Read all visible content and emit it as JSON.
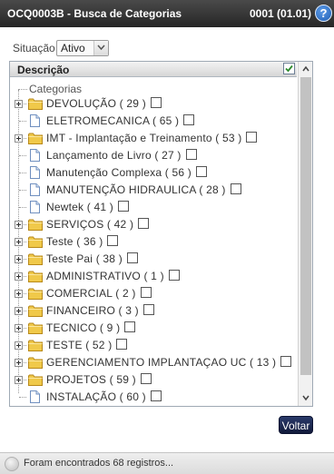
{
  "window": {
    "title": "OCQ0003B - Busca de Categorias",
    "code": "0001 (01.01)",
    "help_icon": "?"
  },
  "filter": {
    "label": "Situação",
    "selected": "Ativo"
  },
  "panel": {
    "column_header": "Descrição",
    "header_checked": true
  },
  "tree": {
    "root": "Categorias",
    "items": [
      {
        "label": "DEVOLUÇÃO ( 29 )",
        "type": "folder",
        "expandable": true
      },
      {
        "label": "ELETROMECANICA ( 65 )",
        "type": "document",
        "expandable": false
      },
      {
        "label": "IMT - Implantação e Treinamento ( 53 )",
        "type": "folder",
        "expandable": true
      },
      {
        "label": "Lançamento de Livro ( 27 )",
        "type": "document",
        "expandable": false
      },
      {
        "label": "Manutenção Complexa ( 56 )",
        "type": "document",
        "expandable": false
      },
      {
        "label": "MANUTENÇÃO HIDRAULICA ( 28 )",
        "type": "document",
        "expandable": false
      },
      {
        "label": "Newtek ( 41 )",
        "type": "document",
        "expandable": false
      },
      {
        "label": "SERVIÇOS ( 42 )",
        "type": "folder",
        "expandable": true
      },
      {
        "label": "Teste ( 36 )",
        "type": "folder",
        "expandable": true
      },
      {
        "label": "Teste Pai ( 38 )",
        "type": "folder",
        "expandable": true
      },
      {
        "label": "ADMINISTRATIVO ( 1 )",
        "type": "folder",
        "expandable": true
      },
      {
        "label": "COMERCIAL ( 2 )",
        "type": "folder",
        "expandable": true
      },
      {
        "label": "FINANCEIRO ( 3 )",
        "type": "folder",
        "expandable": true
      },
      {
        "label": "TECNICO ( 9 )",
        "type": "folder",
        "expandable": true
      },
      {
        "label": "TESTE ( 52 )",
        "type": "folder",
        "expandable": true
      },
      {
        "label": "GERENCIAMENTO IMPLANTAÇAO UC ( 13 )",
        "type": "folder",
        "expandable": true
      },
      {
        "label": "PROJETOS ( 59 )",
        "type": "folder",
        "expandable": true
      },
      {
        "label": "INSTALAÇÃO ( 60 )",
        "type": "document",
        "expandable": false
      }
    ]
  },
  "actions": {
    "back_label": "Voltar"
  },
  "status": {
    "text": "Foram encontrados 68 registros..."
  },
  "colors": {
    "titlebar": "#333333",
    "folder": "#f0c94a",
    "button": "#1a2650"
  }
}
